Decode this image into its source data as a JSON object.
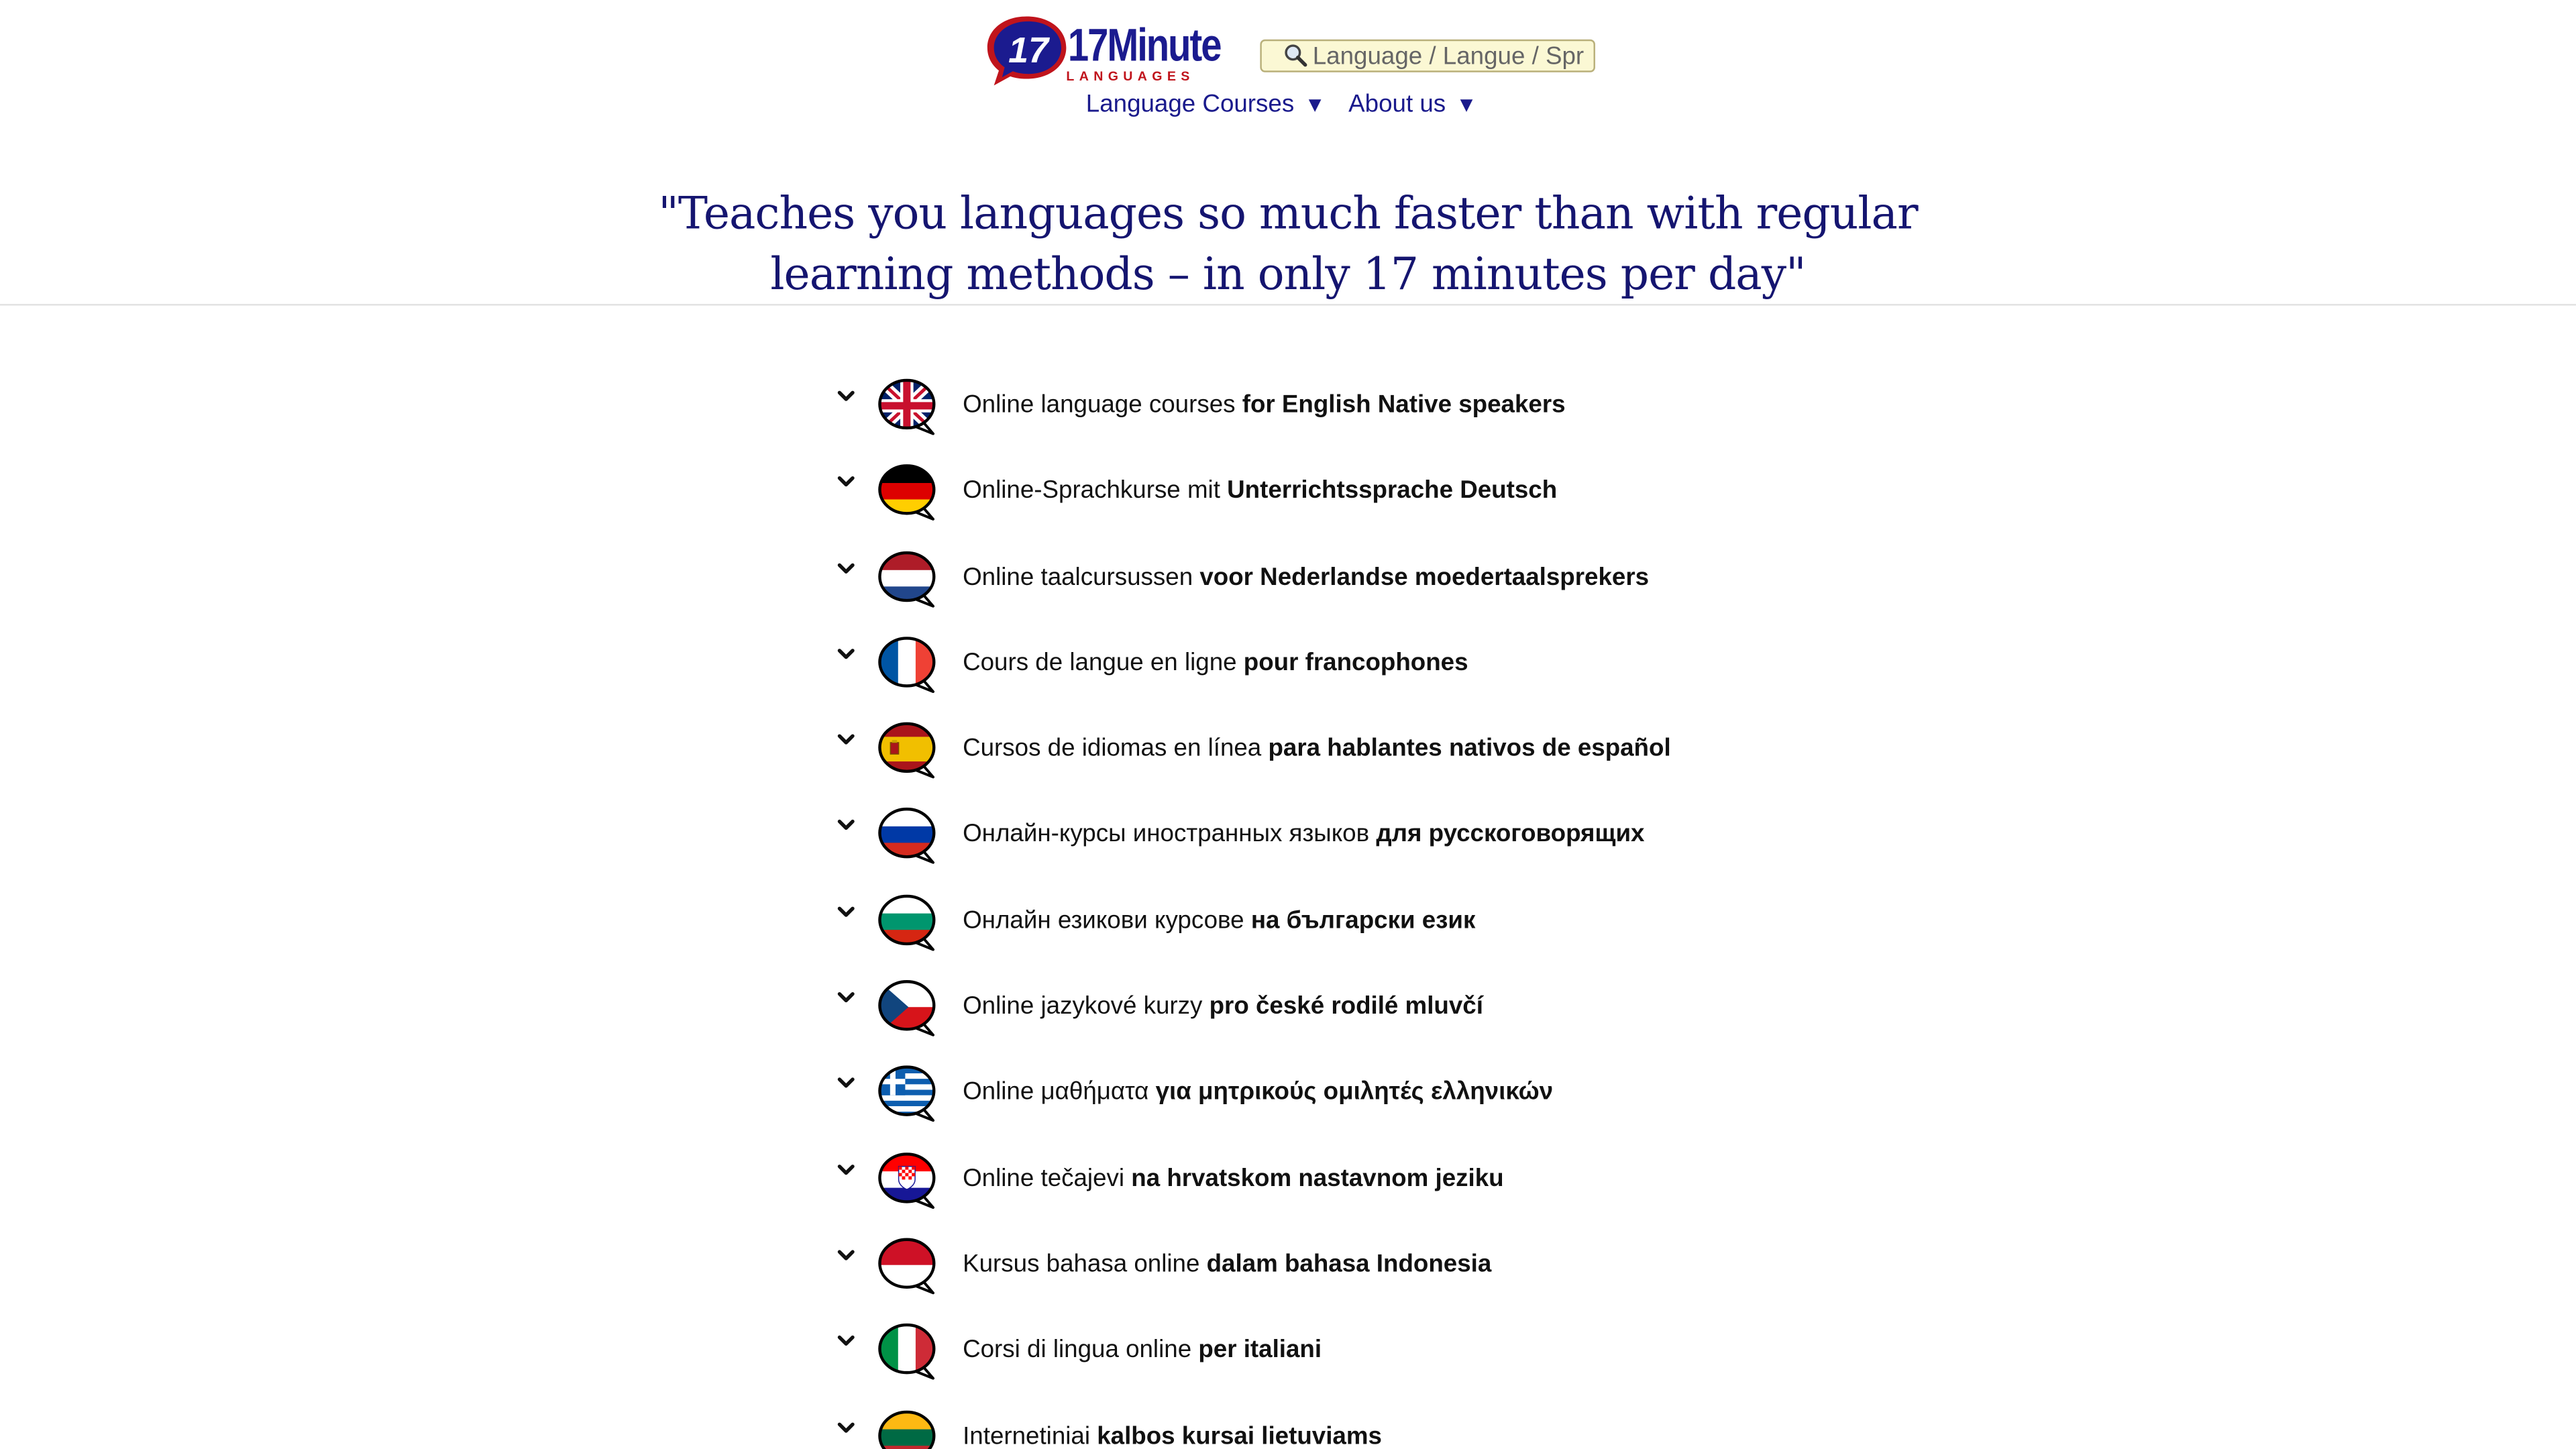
{
  "header": {
    "logo": {
      "text": "17Minute",
      "subtext": "LANGUAGES"
    },
    "search": {
      "placeholder": "Language / Langue / Spr"
    },
    "nav": [
      {
        "label": "Language Courses",
        "arrow": "▼"
      },
      {
        "label": "About us",
        "arrow": "▼"
      }
    ]
  },
  "tagline": {
    "line1": "\"Teaches you languages so much faster than with regular",
    "line2": "learning methods – in only 17 minutes per day\""
  },
  "colors": {
    "brand_blue": "#1b1b8f",
    "brand_red": "#c0141c",
    "tagline": "#151570",
    "search_bg": "#fbf8d4"
  },
  "courses": [
    {
      "flag": "uk-flag-icon",
      "text": "Online language courses ",
      "bold": "for English Native speakers"
    },
    {
      "flag": "germany-flag-icon",
      "text": "Online-Sprachkurse mit ",
      "bold": "Unterrichtssprache Deutsch"
    },
    {
      "flag": "netherlands-flag-icon",
      "text": "Online taalcursussen ",
      "bold": "voor Nederlandse moedertaalsprekers"
    },
    {
      "flag": "france-flag-icon",
      "text": "Cours de langue en ligne ",
      "bold": "pour francophones"
    },
    {
      "flag": "spain-flag-icon",
      "text": "Cursos de idiomas en línea ",
      "bold": "para hablantes nativos de español"
    },
    {
      "flag": "russia-flag-icon",
      "text": "Онлайн-курсы иностранных языков ",
      "bold": "для русскоговорящих"
    },
    {
      "flag": "bulgaria-flag-icon",
      "text": "Онлайн езикови курсове ",
      "bold": "на български език"
    },
    {
      "flag": "czech-flag-icon",
      "text": "Online jazykové kurzy ",
      "bold": "pro české rodilé mluvčí"
    },
    {
      "flag": "greece-flag-icon",
      "text": "Online μαθήματα ",
      "bold": "για μητρικούς ομιλητές ελληνικών"
    },
    {
      "flag": "croatia-flag-icon",
      "text": "Online tečajevi ",
      "bold": "na hrvatskom nastavnom jeziku"
    },
    {
      "flag": "indonesia-flag-icon",
      "text": "Kursus bahasa online ",
      "bold": "dalam bahasa Indonesia"
    },
    {
      "flag": "italy-flag-icon",
      "text": "Corsi di lingua online ",
      "bold": "per italiani"
    },
    {
      "flag": "lithuania-flag-icon",
      "text": "Internetiniai ",
      "bold": "kalbos kursai lietuviams"
    }
  ]
}
